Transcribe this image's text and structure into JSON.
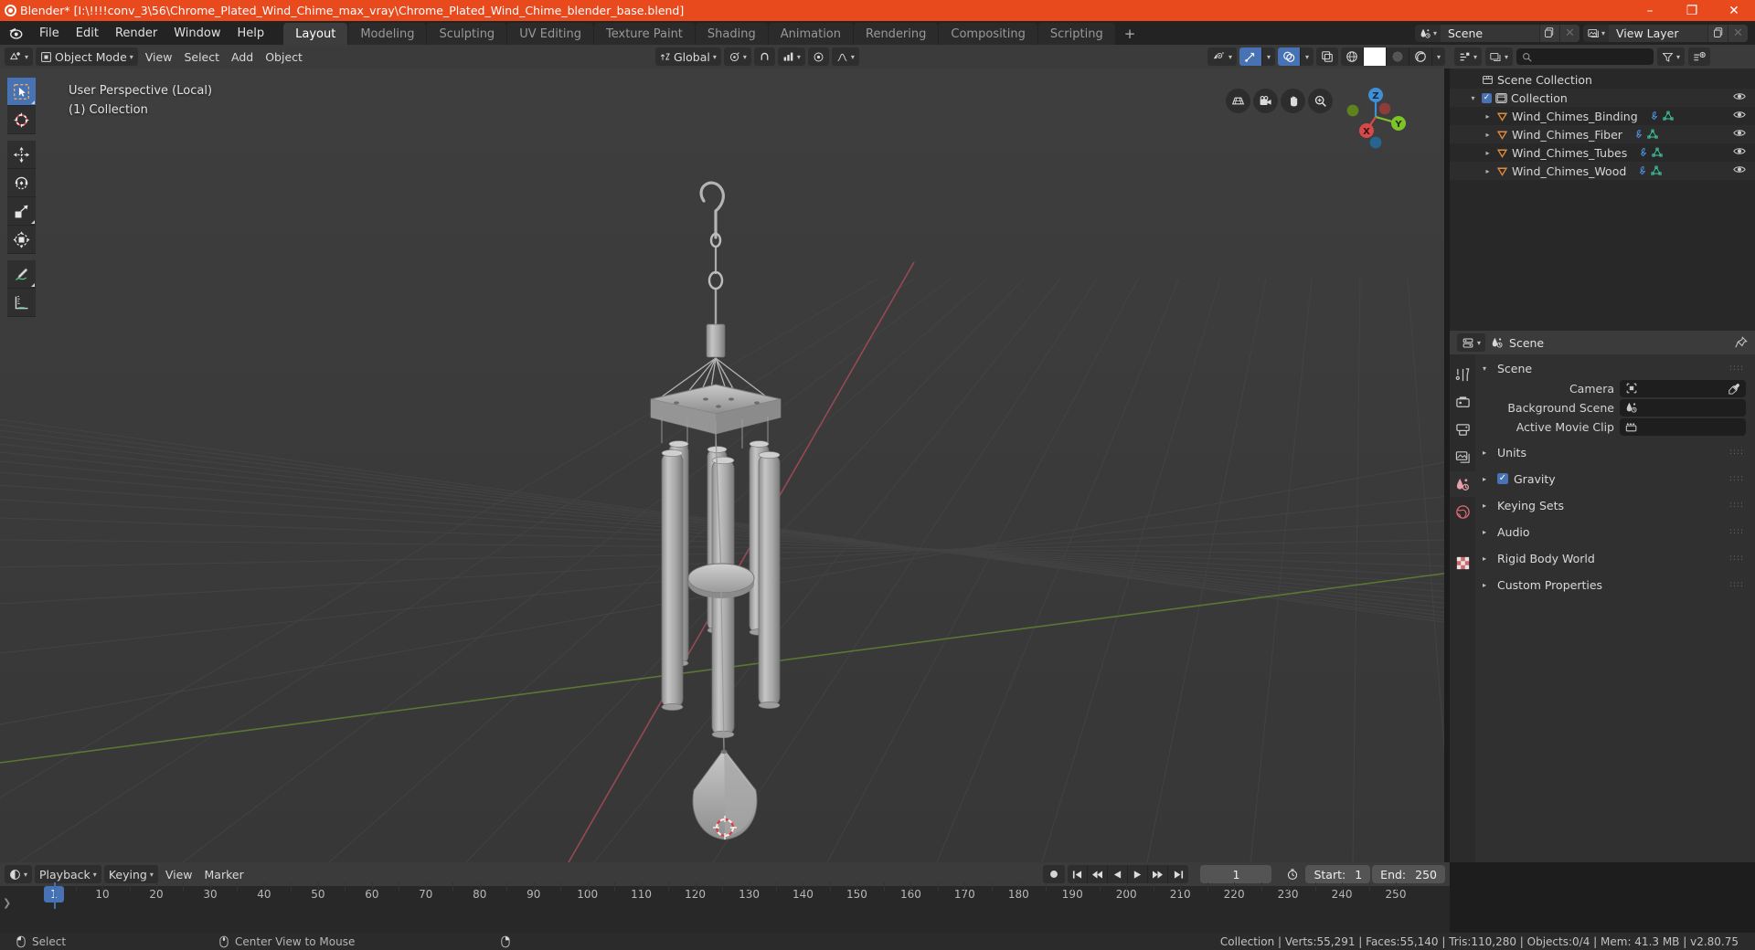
{
  "window": {
    "title": "Blender* [I:\\!!!!conv_3\\56\\Chrome_Plated_Wind_Chime_max_vray\\Chrome_Plated_Wind_Chime_blender_base.blend]",
    "minimize": "–",
    "maximize": "❐",
    "close": "✕",
    "accent_color": "#e8491d"
  },
  "topbar": {
    "menus": [
      "File",
      "Edit",
      "Render",
      "Window",
      "Help"
    ],
    "workspaces": [
      {
        "label": "Layout",
        "active": true
      },
      {
        "label": "Modeling",
        "active": false
      },
      {
        "label": "Sculpting",
        "active": false
      },
      {
        "label": "UV Editing",
        "active": false
      },
      {
        "label": "Texture Paint",
        "active": false
      },
      {
        "label": "Shading",
        "active": false
      },
      {
        "label": "Animation",
        "active": false
      },
      {
        "label": "Rendering",
        "active": false
      },
      {
        "label": "Compositing",
        "active": false
      },
      {
        "label": "Scripting",
        "active": false
      }
    ],
    "add_workspace": "+",
    "scene_name": "Scene",
    "view_layer_name": "View Layer"
  },
  "viewport": {
    "mode": "Object Mode",
    "menus": [
      "View",
      "Select",
      "Add",
      "Object"
    ],
    "transform_orientation": "Global",
    "overlay_text_line1": "User Perspective (Local)",
    "overlay_text_line2": "(1) Collection",
    "gizmo_axes": [
      "X",
      "Y",
      "Z"
    ],
    "tools": [
      {
        "name": "tweak-select-tool",
        "active": true
      },
      {
        "name": "cursor-tool",
        "active": false
      },
      {
        "name": "move-tool",
        "active": false
      },
      {
        "name": "rotate-tool",
        "active": false
      },
      {
        "name": "scale-tool",
        "active": false
      },
      {
        "name": "transform-tool",
        "active": false
      },
      {
        "name": "annotate-tool",
        "active": false
      },
      {
        "name": "measure-tool",
        "active": false
      }
    ],
    "nav_buttons": [
      "toggle-perspective-ortho",
      "camera-view",
      "pan-view",
      "zoom-view"
    ],
    "shading_modes": [
      "wireframe",
      "solid",
      "material-preview",
      "rendered"
    ],
    "shading_active": "solid"
  },
  "outliner": {
    "display_mode": "View Layer",
    "search_placeholder": "",
    "rows": [
      {
        "label": "Scene Collection",
        "indent": 0,
        "icon": "collection-icon",
        "has_tri": false,
        "has_checkbox": false,
        "mods": [],
        "eye": false
      },
      {
        "label": "Collection",
        "indent": 1,
        "icon": "collection-icon",
        "has_tri": true,
        "has_checkbox": true,
        "mods": [],
        "eye": true
      },
      {
        "label": "Wind_Chimes_Binding",
        "indent": 2,
        "icon": "mesh-object-icon",
        "has_tri": true,
        "has_checkbox": false,
        "mods": [
          "modifier-icon",
          "mesh-data-icon"
        ],
        "eye": true
      },
      {
        "label": "Wind_Chimes_Fiber",
        "indent": 2,
        "icon": "mesh-object-icon",
        "has_tri": true,
        "has_checkbox": false,
        "mods": [
          "modifier-icon",
          "mesh-data-icon"
        ],
        "eye": true
      },
      {
        "label": "Wind_Chimes_Tubes",
        "indent": 2,
        "icon": "mesh-object-icon",
        "has_tri": true,
        "has_checkbox": false,
        "mods": [
          "modifier-icon",
          "mesh-data-icon"
        ],
        "eye": true
      },
      {
        "label": "Wind_Chimes_Wood",
        "indent": 2,
        "icon": "mesh-object-icon",
        "has_tri": true,
        "has_checkbox": false,
        "mods": [
          "modifier-icon",
          "mesh-data-icon"
        ],
        "eye": true
      }
    ]
  },
  "properties": {
    "breadcrumb": "Scene",
    "tabs": [
      {
        "name": "tool-tab",
        "active": false
      },
      {
        "name": "render-tab",
        "active": false
      },
      {
        "name": "output-tab",
        "active": false
      },
      {
        "name": "view-layer-tab",
        "active": false
      },
      {
        "name": "scene-tab",
        "active": true
      },
      {
        "name": "world-tab",
        "active": false
      },
      {
        "name": "texture-tab",
        "active": false
      }
    ],
    "scene_panel_title": "Scene",
    "fields": [
      {
        "label": "Camera",
        "value": "",
        "icon": "camera-icon",
        "has_eyedropper": true
      },
      {
        "label": "Background Scene",
        "value": "",
        "icon": "scene-icon",
        "has_eyedropper": false
      },
      {
        "label": "Active Movie Clip",
        "value": "",
        "icon": "clip-icon",
        "has_eyedropper": false
      }
    ],
    "panels": [
      {
        "label": "Units",
        "checkbox": false,
        "checked": false
      },
      {
        "label": "Gravity",
        "checkbox": true,
        "checked": true
      },
      {
        "label": "Keying Sets",
        "checkbox": false,
        "checked": false
      },
      {
        "label": "Audio",
        "checkbox": false,
        "checked": false
      },
      {
        "label": "Rigid Body World",
        "checkbox": false,
        "checked": false
      },
      {
        "label": "Custom Properties",
        "checkbox": false,
        "checked": false
      }
    ]
  },
  "timeline": {
    "menus": [
      "Playback",
      "Keying",
      "View",
      "Marker"
    ],
    "current_frame": "1",
    "start_label": "Start:",
    "start_value": "1",
    "end_label": "End:",
    "end_value": "250",
    "ticks": [
      10,
      20,
      30,
      40,
      50,
      60,
      70,
      80,
      90,
      100,
      110,
      120,
      130,
      140,
      150,
      160,
      170,
      180,
      190,
      200,
      210,
      220,
      230,
      240,
      250
    ],
    "cursor_label": "1"
  },
  "statusbar": {
    "left_items": [
      {
        "icon": "mouse-left-icon",
        "label": "Select"
      },
      {
        "icon": "mouse-middle-icon",
        "label": "Center View to Mouse"
      },
      {
        "icon": "mouse-right-icon",
        "label": ""
      }
    ],
    "stats": "Collection | Verts:55,291 | Faces:55,140 | Tris:110,280 | Objects:0/4 | Mem: 41.3 MB | v2.80.75"
  }
}
